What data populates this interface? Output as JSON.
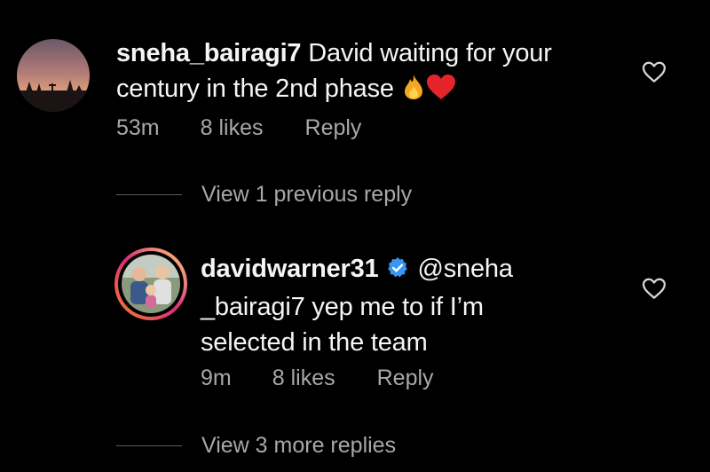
{
  "comments": [
    {
      "username": "sneha_bairagi7",
      "text": "David waiting for your century in the 2nd phase",
      "emojis": [
        "fire-emoji",
        "red-heart-emoji"
      ],
      "time": "53m",
      "likes": "8 likes",
      "reply_label": "Reply"
    },
    {
      "username": "davidwarner31",
      "verified": true,
      "mention": "@sneha _bairagi7",
      "text_line1_after": "@sneha",
      "text_line2": "_bairagi7 yep me to if I’m",
      "text_line3": "selected in the team",
      "time": "9m",
      "likes": "8 likes",
      "reply_label": "Reply"
    }
  ],
  "first_comment_lines": {
    "line1_rest": "David waiting for your",
    "line2": "century in the 2nd phase"
  },
  "view_previous": "View 1 previous reply",
  "view_more": "View 3 more replies",
  "icons": {
    "like": "heart-outline-icon",
    "verified": "verified-badge-icon"
  },
  "colors": {
    "background": "#000000",
    "text": "#f5f5f5",
    "secondary": "#a8a8a8",
    "verified": "#3897f0",
    "story_ring_start": "#f58529",
    "story_ring_end": "#dd2a7b"
  }
}
